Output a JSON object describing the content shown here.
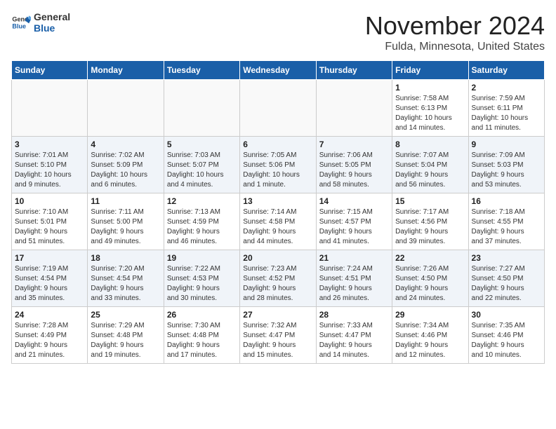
{
  "header": {
    "logo_general": "General",
    "logo_blue": "Blue",
    "month": "November 2024",
    "location": "Fulda, Minnesota, United States"
  },
  "calendar": {
    "weekdays": [
      "Sunday",
      "Monday",
      "Tuesday",
      "Wednesday",
      "Thursday",
      "Friday",
      "Saturday"
    ],
    "weeks": [
      [
        {
          "day": "",
          "info": ""
        },
        {
          "day": "",
          "info": ""
        },
        {
          "day": "",
          "info": ""
        },
        {
          "day": "",
          "info": ""
        },
        {
          "day": "",
          "info": ""
        },
        {
          "day": "1",
          "info": "Sunrise: 7:58 AM\nSunset: 6:13 PM\nDaylight: 10 hours\nand 14 minutes."
        },
        {
          "day": "2",
          "info": "Sunrise: 7:59 AM\nSunset: 6:11 PM\nDaylight: 10 hours\nand 11 minutes."
        }
      ],
      [
        {
          "day": "3",
          "info": "Sunrise: 7:01 AM\nSunset: 5:10 PM\nDaylight: 10 hours\nand 9 minutes."
        },
        {
          "day": "4",
          "info": "Sunrise: 7:02 AM\nSunset: 5:09 PM\nDaylight: 10 hours\nand 6 minutes."
        },
        {
          "day": "5",
          "info": "Sunrise: 7:03 AM\nSunset: 5:07 PM\nDaylight: 10 hours\nand 4 minutes."
        },
        {
          "day": "6",
          "info": "Sunrise: 7:05 AM\nSunset: 5:06 PM\nDaylight: 10 hours\nand 1 minute."
        },
        {
          "day": "7",
          "info": "Sunrise: 7:06 AM\nSunset: 5:05 PM\nDaylight: 9 hours\nand 58 minutes."
        },
        {
          "day": "8",
          "info": "Sunrise: 7:07 AM\nSunset: 5:04 PM\nDaylight: 9 hours\nand 56 minutes."
        },
        {
          "day": "9",
          "info": "Sunrise: 7:09 AM\nSunset: 5:03 PM\nDaylight: 9 hours\nand 53 minutes."
        }
      ],
      [
        {
          "day": "10",
          "info": "Sunrise: 7:10 AM\nSunset: 5:01 PM\nDaylight: 9 hours\nand 51 minutes."
        },
        {
          "day": "11",
          "info": "Sunrise: 7:11 AM\nSunset: 5:00 PM\nDaylight: 9 hours\nand 49 minutes."
        },
        {
          "day": "12",
          "info": "Sunrise: 7:13 AM\nSunset: 4:59 PM\nDaylight: 9 hours\nand 46 minutes."
        },
        {
          "day": "13",
          "info": "Sunrise: 7:14 AM\nSunset: 4:58 PM\nDaylight: 9 hours\nand 44 minutes."
        },
        {
          "day": "14",
          "info": "Sunrise: 7:15 AM\nSunset: 4:57 PM\nDaylight: 9 hours\nand 41 minutes."
        },
        {
          "day": "15",
          "info": "Sunrise: 7:17 AM\nSunset: 4:56 PM\nDaylight: 9 hours\nand 39 minutes."
        },
        {
          "day": "16",
          "info": "Sunrise: 7:18 AM\nSunset: 4:55 PM\nDaylight: 9 hours\nand 37 minutes."
        }
      ],
      [
        {
          "day": "17",
          "info": "Sunrise: 7:19 AM\nSunset: 4:54 PM\nDaylight: 9 hours\nand 35 minutes."
        },
        {
          "day": "18",
          "info": "Sunrise: 7:20 AM\nSunset: 4:54 PM\nDaylight: 9 hours\nand 33 minutes."
        },
        {
          "day": "19",
          "info": "Sunrise: 7:22 AM\nSunset: 4:53 PM\nDaylight: 9 hours\nand 30 minutes."
        },
        {
          "day": "20",
          "info": "Sunrise: 7:23 AM\nSunset: 4:52 PM\nDaylight: 9 hours\nand 28 minutes."
        },
        {
          "day": "21",
          "info": "Sunrise: 7:24 AM\nSunset: 4:51 PM\nDaylight: 9 hours\nand 26 minutes."
        },
        {
          "day": "22",
          "info": "Sunrise: 7:26 AM\nSunset: 4:50 PM\nDaylight: 9 hours\nand 24 minutes."
        },
        {
          "day": "23",
          "info": "Sunrise: 7:27 AM\nSunset: 4:50 PM\nDaylight: 9 hours\nand 22 minutes."
        }
      ],
      [
        {
          "day": "24",
          "info": "Sunrise: 7:28 AM\nSunset: 4:49 PM\nDaylight: 9 hours\nand 21 minutes."
        },
        {
          "day": "25",
          "info": "Sunrise: 7:29 AM\nSunset: 4:48 PM\nDaylight: 9 hours\nand 19 minutes."
        },
        {
          "day": "26",
          "info": "Sunrise: 7:30 AM\nSunset: 4:48 PM\nDaylight: 9 hours\nand 17 minutes."
        },
        {
          "day": "27",
          "info": "Sunrise: 7:32 AM\nSunset: 4:47 PM\nDaylight: 9 hours\nand 15 minutes."
        },
        {
          "day": "28",
          "info": "Sunrise: 7:33 AM\nSunset: 4:47 PM\nDaylight: 9 hours\nand 14 minutes."
        },
        {
          "day": "29",
          "info": "Sunrise: 7:34 AM\nSunset: 4:46 PM\nDaylight: 9 hours\nand 12 minutes."
        },
        {
          "day": "30",
          "info": "Sunrise: 7:35 AM\nSunset: 4:46 PM\nDaylight: 9 hours\nand 10 minutes."
        }
      ]
    ]
  }
}
